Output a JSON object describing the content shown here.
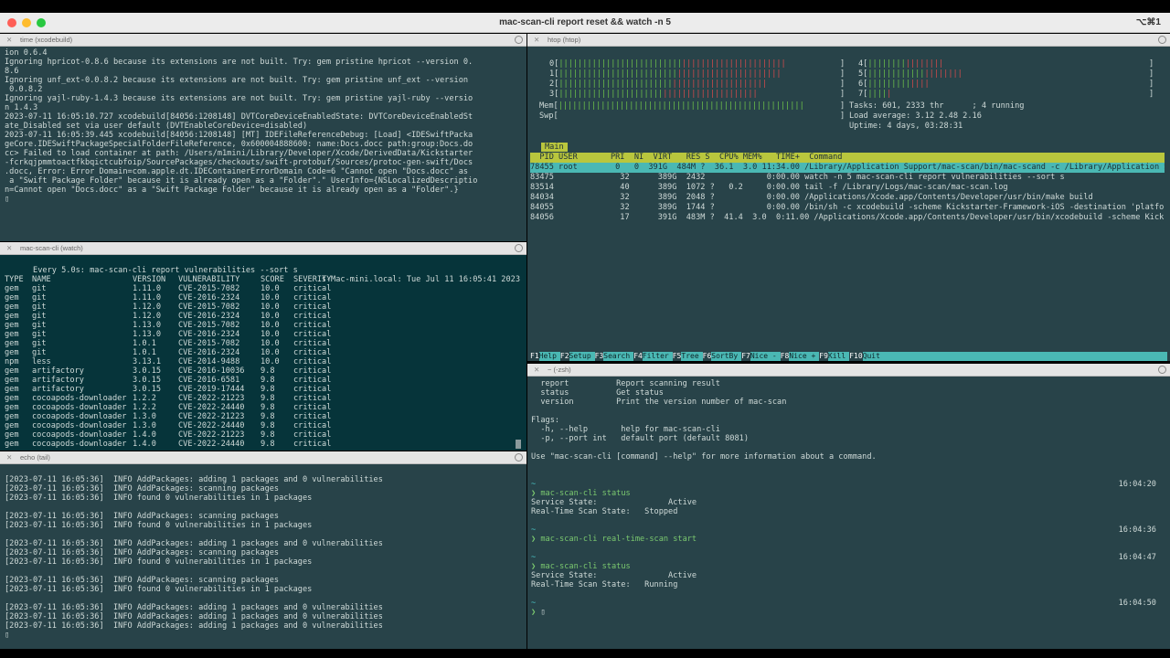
{
  "window": {
    "title": "mac-scan-cli report reset && watch -n 5",
    "shortcut": "⌥⌘1"
  },
  "pane_time": {
    "title": "time (xcodebuild)",
    "lines": [
      "ion 0.6.4",
      "Ignoring hpricot-0.8.6 because its extensions are not built. Try: gem pristine hpricot --version 0.",
      "8.6",
      "Ignoring unf_ext-0.0.8.2 because its extensions are not built. Try: gem pristine unf_ext --version",
      " 0.0.8.2",
      "Ignoring yajl-ruby-1.4.3 because its extensions are not built. Try: gem pristine yajl-ruby --versio",
      "n 1.4.3",
      "2023-07-11 16:05:10.727 xcodebuild[84056:1208148] DVTCoreDeviceEnabledState: DVTCoreDeviceEnabledSt",
      "ate_Disabled set via user default (DVTEnableCoreDevice=disabled)",
      "2023-07-11 16:05:39.445 xcodebuild[84056:1208148] [MT] IDEFileReferenceDebug: [Load] <IDESwiftPacka",
      "geCore.IDESwiftPackageSpecialFolderFileReference, 0x600004888600: name:Docs.docc path:group:Docs.do",
      "cc> Failed to load container at path: /Users/m1mini/Library/Developer/Xcode/DerivedData/Kickstarter",
      "-fcrkqjpmmtoactfkbqictcubfoip/SourcePackages/checkouts/swift-protobuf/Sources/protoc-gen-swift/Docs",
      ".docc, Error: Error Domain=com.apple.dt.IDEContainerErrorDomain Code=6 \"Cannot open \"Docs.docc\" as",
      " a \"Swift Package Folder\" because it is already open as a \"Folder\".\" UserInfo={NSLocalizedDescriptio",
      "n=Cannot open \"Docs.docc\" as a \"Swift Package Folder\" because it is already open as a \"Folder\".}",
      "▯"
    ]
  },
  "pane_watch": {
    "title": "mac-scan-cli (watch)",
    "header_left": "Every 5.0s: mac-scan-cli report vulnerabilities --sort s",
    "header_right": "s-Mac-mini.local: Tue Jul 11 16:05:41 2023",
    "columns": [
      "TYPE",
      "NAME",
      "VERSION",
      "VULNERABILITY",
      "SCORE",
      "SEVERITY"
    ],
    "rows": [
      [
        "gem",
        "git",
        "1.11.0",
        "CVE-2015-7082",
        "10.0",
        "critical"
      ],
      [
        "gem",
        "git",
        "1.11.0",
        "CVE-2016-2324",
        "10.0",
        "critical"
      ],
      [
        "gem",
        "git",
        "1.12.0",
        "CVE-2015-7082",
        "10.0",
        "critical"
      ],
      [
        "gem",
        "git",
        "1.12.0",
        "CVE-2016-2324",
        "10.0",
        "critical"
      ],
      [
        "gem",
        "git",
        "1.13.0",
        "CVE-2015-7082",
        "10.0",
        "critical"
      ],
      [
        "gem",
        "git",
        "1.13.0",
        "CVE-2016-2324",
        "10.0",
        "critical"
      ],
      [
        "gem",
        "git",
        "1.0.1",
        "CVE-2015-7082",
        "10.0",
        "critical"
      ],
      [
        "gem",
        "git",
        "1.0.1",
        "CVE-2016-2324",
        "10.0",
        "critical"
      ],
      [
        "npm",
        "less",
        "3.13.1",
        "CVE-2014-9488",
        "10.0",
        "critical"
      ],
      [
        "gem",
        "artifactory",
        "3.0.15",
        "CVE-2016-10036",
        "9.8",
        "critical"
      ],
      [
        "gem",
        "artifactory",
        "3.0.15",
        "CVE-2016-6581",
        "9.8",
        "critical"
      ],
      [
        "gem",
        "artifactory",
        "3.0.15",
        "CVE-2019-17444",
        "9.8",
        "critical"
      ],
      [
        "gem",
        "cocoapods-downloader",
        "1.2.2",
        "CVE-2022-21223",
        "9.8",
        "critical"
      ],
      [
        "gem",
        "cocoapods-downloader",
        "1.2.2",
        "CVE-2022-24440",
        "9.8",
        "critical"
      ],
      [
        "gem",
        "cocoapods-downloader",
        "1.3.0",
        "CVE-2022-21223",
        "9.8",
        "critical"
      ],
      [
        "gem",
        "cocoapods-downloader",
        "1.3.0",
        "CVE-2022-24440",
        "9.8",
        "critical"
      ],
      [
        "gem",
        "cocoapods-downloader",
        "1.4.0",
        "CVE-2022-21223",
        "9.8",
        "critical"
      ],
      [
        "gem",
        "cocoapods-downloader",
        "1.4.0",
        "CVE-2022-24440",
        "9.8",
        "critical"
      ]
    ]
  },
  "pane_tail": {
    "title": "echo (tail)",
    "lines": [
      "[2023-07-11 16:05:36]  INFO AddPackages: adding 1 packages and 0 vulnerabilities",
      "[2023-07-11 16:05:36]  INFO AddPackages: scanning packages",
      "[2023-07-11 16:05:36]  INFO found 0 vulnerabilities in 1 packages",
      "",
      "[2023-07-11 16:05:36]  INFO AddPackages: scanning packages",
      "[2023-07-11 16:05:36]  INFO found 0 vulnerabilities in 1 packages",
      "",
      "[2023-07-11 16:05:36]  INFO AddPackages: adding 1 packages and 0 vulnerabilities",
      "[2023-07-11 16:05:36]  INFO AddPackages: scanning packages",
      "[2023-07-11 16:05:36]  INFO found 0 vulnerabilities in 1 packages",
      "",
      "[2023-07-11 16:05:36]  INFO AddPackages: scanning packages",
      "[2023-07-11 16:05:36]  INFO found 0 vulnerabilities in 1 packages",
      "",
      "[2023-07-11 16:05:36]  INFO AddPackages: adding 1 packages and 0 vulnerabilities",
      "[2023-07-11 16:05:36]  INFO AddPackages: adding 1 packages and 0 vulnerabilities",
      "[2023-07-11 16:05:36]  INFO AddPackages: adding 1 packages and 0 vulnerabilities",
      "▯"
    ]
  },
  "pane_htop": {
    "title": "htop (htop)",
    "cpu_labels": [
      "0[",
      "1[",
      "2[",
      "3["
    ],
    "cpu_labels_right": [
      "4[",
      "5[",
      "6[",
      "7["
    ],
    "mem_label": "Mem[",
    "swp_label": "Swp[",
    "tasks": "Tasks: 601, 2333 thr      ; 4 running",
    "load": "Load average: 3.12 2.48 2.16",
    "uptime": "Uptime: 4 days, 03:28:31",
    "tab": "Main",
    "header": "  PID USER       PRI  NI  VIRT   RES S  CPU% MEM%   TIME+  Command",
    "processes": [
      "78455 root        0   0  391G  484M ?  36.1  3.0 11:34.00 /Library/Application Support/mac-scan/bin/mac-scand -c /Library/Application Supp",
      "83475              32      389G  2432             0:00.00 watch -n 5 mac-scan-cli report vulnerabilities --sort s",
      "83514              40      389G  1072 ?   0.2     0:00.00 tail -f /Library/Logs/mac-scan/mac-scan.log",
      "84034              32      389G  2048 ?           0:00.00 /Applications/Xcode.app/Contents/Developer/usr/bin/make build",
      "84055              32      389G  1744 ?           0:00.00 /bin/sh -c xcodebuild -scheme Kickstarter-Framework-iOS -destination 'platform=i",
      "84056              17      391G  483M ?  41.4  3.0  0:11.00 /Applications/Xcode.app/Contents/Developer/usr/bin/xcodebuild -scheme Kickstarte"
    ],
    "fkeys": [
      {
        "key": "F1",
        "label": "Help"
      },
      {
        "key": "F2",
        "label": "Setup"
      },
      {
        "key": "F3",
        "label": "Search"
      },
      {
        "key": "F4",
        "label": "Filter"
      },
      {
        "key": "F5",
        "label": "Tree"
      },
      {
        "key": "F6",
        "label": "SortBy"
      },
      {
        "key": "F7",
        "label": "Nice -"
      },
      {
        "key": "F8",
        "label": "Nice +"
      },
      {
        "key": "F9",
        "label": "Kill"
      },
      {
        "key": "F10",
        "label": "Quit"
      }
    ]
  },
  "pane_zsh": {
    "title": "~ (-zsh)",
    "help_lines": [
      "  report          Report scanning result",
      "  status          Get status",
      "  version         Print the version number of mac-scan",
      "",
      "Flags:",
      "  -h, --help       help for mac-scan-cli",
      "  -p, --port int   default port (default 8081)",
      "",
      "Use \"mac-scan-cli [command] --help\" for more information about a command."
    ],
    "sessions": [
      {
        "time": "16:04:20",
        "cmd": "mac-scan-cli status",
        "out": [
          "Service State:               Active",
          "Real-Time Scan State:   Stopped"
        ]
      },
      {
        "time": "16:04:36",
        "cmd": "mac-scan-cli real-time-scan start",
        "out": []
      },
      {
        "time": "16:04:47",
        "cmd": "mac-scan-cli status",
        "out": [
          "Service State:               Active",
          "Real-Time Scan State:   Running"
        ]
      },
      {
        "time": "16:04:50",
        "cmd": "",
        "out": []
      }
    ],
    "tilde": "~",
    "prompt": "❯"
  }
}
